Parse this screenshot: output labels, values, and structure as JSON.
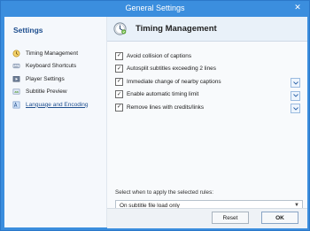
{
  "window": {
    "title": "General Settings"
  },
  "sidebar": {
    "heading": "Settings",
    "items": [
      {
        "label": "Timing Management",
        "icon": "clock-icon"
      },
      {
        "label": "Keyboard Shortcuts",
        "icon": "keyboard-icon"
      },
      {
        "label": "Player Settings",
        "icon": "player-icon"
      },
      {
        "label": "Subtitle Preview",
        "icon": "preview-icon"
      },
      {
        "label": "Language and Encoding",
        "icon": "language-icon",
        "active": true
      }
    ]
  },
  "panel": {
    "title": "Timing Management",
    "options": [
      {
        "label": "Avoid collision of captions",
        "checked": true,
        "expandable": false
      },
      {
        "label": "Autosplit subtitles exceeding 2 lines",
        "checked": true,
        "expandable": false
      },
      {
        "label": "Immediate change of nearby captions",
        "checked": true,
        "expandable": true
      },
      {
        "label": "Enable automatic timing limit",
        "checked": true,
        "expandable": true
      },
      {
        "label": "Remove lines with credits/links",
        "checked": true,
        "expandable": true
      }
    ],
    "apply_label": "Select when to apply the selected rules:",
    "apply_value": "On subtitle file load only"
  },
  "buttons": {
    "reset": "Reset",
    "ok": "OK"
  }
}
